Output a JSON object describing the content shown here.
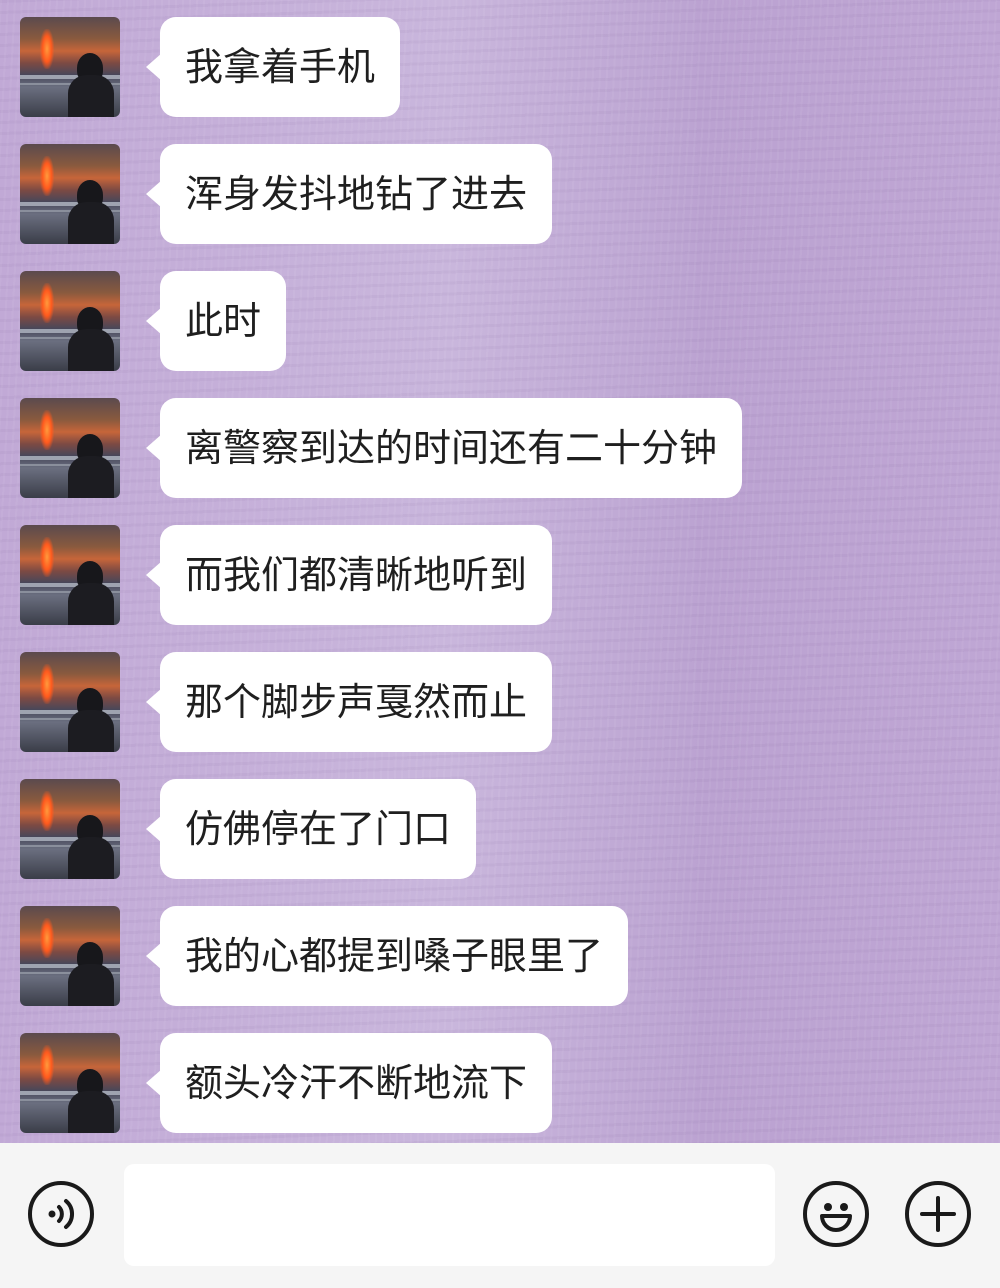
{
  "messages": [
    {
      "text": "我拿着手机"
    },
    {
      "text": "浑身发抖地钻了进去"
    },
    {
      "text": "此时"
    },
    {
      "text": "离警察到达的时间还有二十分钟"
    },
    {
      "text": "而我们都清晰地听到"
    },
    {
      "text": "那个脚步声戛然而止"
    },
    {
      "text": "仿佛停在了门口"
    },
    {
      "text": "我的心都提到嗓子眼里了"
    },
    {
      "text": "额头冷汗不断地流下"
    }
  ],
  "input_bar": {
    "text_value": "",
    "voice_icon": "voice-icon",
    "emoji_icon": "emoji-icon",
    "plus_icon": "plus-icon"
  },
  "colors": {
    "chat_background": "#c3aed5",
    "bubble": "#ffffff",
    "input_bar": "#f5f5f5"
  }
}
